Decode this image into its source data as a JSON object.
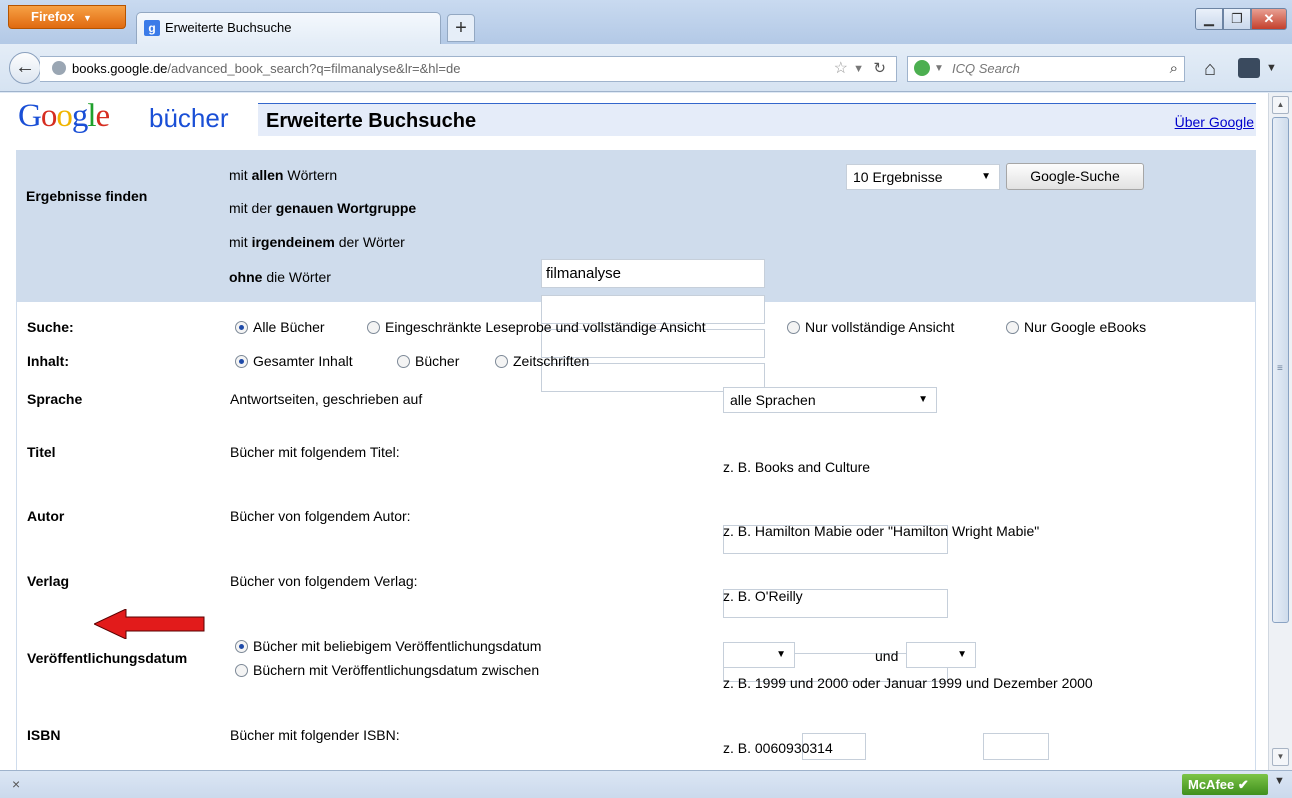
{
  "browser": {
    "menu_button": "Firefox",
    "tab_title": "Erweiterte Buchsuche",
    "new_tab": "+",
    "url_domain": "books.google.de",
    "url_path": "/advanced_book_search?q=filmanalyse&lr=&hl=de",
    "search_placeholder": "ICQ Search"
  },
  "header": {
    "logo_suffix": "bücher",
    "title": "Erweiterte Buchsuche",
    "about_link": "Über Google"
  },
  "find": {
    "heading": "Ergebnisse finden",
    "all_words": {
      "pre": "mit ",
      "bold": "allen",
      "post": " Wörtern",
      "value": "filmanalyse"
    },
    "exact_phrase": {
      "pre": "mit der ",
      "bold": "genauen Wortgruppe",
      "post": "",
      "value": ""
    },
    "any_words": {
      "pre": "mit ",
      "bold": "irgendeinem",
      "post": " der Wörter",
      "value": ""
    },
    "none_words": {
      "pre": "",
      "bold": "ohne",
      "post": " die Wörter",
      "value": ""
    },
    "results_select": "10 Ergebnisse",
    "search_button": "Google-Suche"
  },
  "search_scope": {
    "label": "Suche:",
    "options": [
      "Alle Bücher",
      "Eingeschränkte Leseprobe und vollständige Ansicht",
      "Nur vollständige Ansicht",
      "Nur Google eBooks"
    ],
    "selected": 0
  },
  "content": {
    "label": "Inhalt:",
    "options": [
      "Gesamter Inhalt",
      "Bücher",
      "Zeitschriften"
    ],
    "selected": 0
  },
  "language": {
    "label": "Sprache",
    "desc": "Antwortseiten, geschrieben auf",
    "select": "alle Sprachen"
  },
  "title_row": {
    "label": "Titel",
    "desc": "Bücher mit folgendem Titel:",
    "hint": "z. B. Books and Culture"
  },
  "author_row": {
    "label": "Autor",
    "desc": "Bücher von folgendem Autor:",
    "hint": "z. B. Hamilton Mabie oder \"Hamilton Wright Mabie\""
  },
  "publisher_row": {
    "label": "Verlag",
    "desc": "Bücher von folgendem Verlag:",
    "hint": "z. B. O'Reilly"
  },
  "date_row": {
    "label": "Veröffentlichungsdatum",
    "options": [
      "Bücher mit beliebigem Veröffentlichungsdatum",
      "Büchern mit Veröffentlichungsdatum zwischen"
    ],
    "selected": 0,
    "and": "und",
    "hint": "z. B. 1999 und 2000 oder Januar 1999 und Dezember 2000"
  },
  "isbn_row": {
    "label": "ISBN",
    "desc": "Bücher mit folgender ISBN:",
    "hint": "z. B. 0060930314"
  },
  "statusbar": {
    "close": "×",
    "addon": "McAfee"
  },
  "colors": {
    "accent_arrow": "#e21b1b",
    "panel": "#cfdcec",
    "link": "#0000cc"
  }
}
